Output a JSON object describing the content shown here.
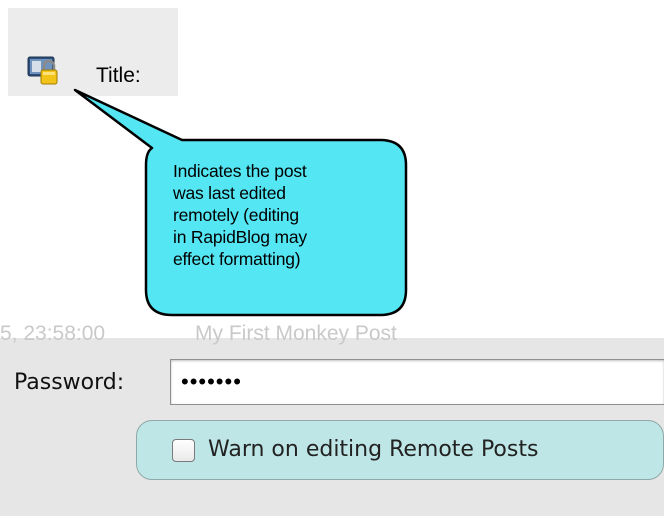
{
  "title_row": {
    "icon": "remote-edit-lock-icon",
    "label": "Title:"
  },
  "callout": {
    "text": "Indicates the post\nwas last edited\nremotely (editing\nin RapidBlog may\neffect formatting)",
    "fill_color": "#55e6f4"
  },
  "background_row": {
    "date": "5, 23:58:00",
    "post_title": "My First Monkey Post"
  },
  "password": {
    "label": "Password:",
    "value": "•••••••"
  },
  "warn_option": {
    "label": "Warn on editing Remote Posts",
    "checked": false,
    "highlight_color": "#bfe6e6"
  }
}
